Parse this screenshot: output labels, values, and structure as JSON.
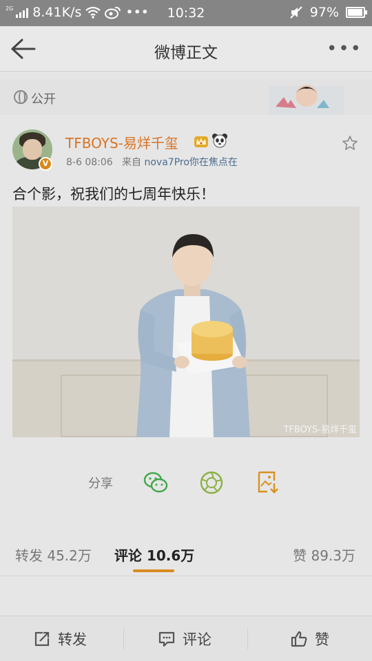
{
  "status_bar": {
    "network_type": "2G",
    "speed": "8.41K/s",
    "more": "•••",
    "time": "10:32",
    "battery": "97%",
    "battery_level": 0.97
  },
  "nav": {
    "title": "微博正文",
    "more_label": "•••"
  },
  "visibility": {
    "label": "公开"
  },
  "post": {
    "username": "TFBOYS-易烊千玺",
    "date": "8-6 08:06",
    "source_prefix": "来自",
    "source": "nova7Pro你在焦点在",
    "text": "合个影，祝我们的七周年快乐！",
    "watermark": "TFBOYS-易烊千玺",
    "avatar_badge": "V"
  },
  "share": {
    "label": "分享"
  },
  "tabs": {
    "repost": "转发 45.2万",
    "comment": "评论 10.6万",
    "like": "赞 89.3万"
  },
  "bottom": {
    "repost": "转发",
    "comment": "评论",
    "like": "赞"
  },
  "colors": {
    "accent": "#d98a1e",
    "username": "#d87323",
    "link": "#4a6b8f",
    "wechat": "#3fa84a",
    "moments": "#8bb043",
    "save": "#d9901f"
  }
}
